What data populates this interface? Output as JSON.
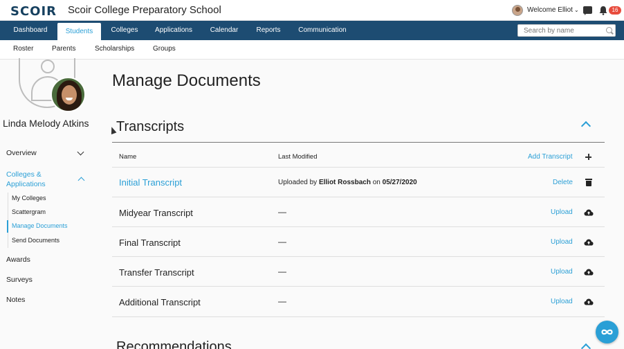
{
  "header": {
    "logo": "SCOIR",
    "school": "Scoir College Preparatory School",
    "welcome": "Welcome Elliot",
    "notification_count": "16"
  },
  "nav": {
    "tabs": [
      "Dashboard",
      "Students",
      "Colleges",
      "Applications",
      "Calendar",
      "Reports",
      "Communication"
    ],
    "active": "Students",
    "search_placeholder": "Search by name"
  },
  "subnav": {
    "items": [
      "Roster",
      "Parents",
      "Scholarships",
      "Groups"
    ]
  },
  "sidebar": {
    "student_name": "Linda Melody Atkins",
    "overview": "Overview",
    "colleges_applications": "Colleges & Applications",
    "sub_items": [
      "My Colleges",
      "Scattergram",
      "Manage Documents",
      "Send Documents"
    ],
    "active_sub_item": "Manage Documents",
    "awards": "Awards",
    "surveys": "Surveys",
    "notes": "Notes"
  },
  "main": {
    "page_title": "Manage Documents",
    "section_title": "Transcripts",
    "columns": {
      "name": "Name",
      "last_modified": "Last Modified",
      "add_action": "Add Transcript"
    },
    "rows": [
      {
        "name": "Initial Transcript",
        "uploaded_prefix": "Uploaded by",
        "uploaded_by": "Elliot Rossbach",
        "uploaded_on": "on",
        "date": "05/27/2020",
        "action": "Delete"
      },
      {
        "name": "Midyear Transcript",
        "last_modified": "—",
        "action": "Upload"
      },
      {
        "name": "Final Transcript",
        "last_modified": "—",
        "action": "Upload"
      },
      {
        "name": "Transfer Transcript",
        "last_modified": "—",
        "action": "Upload"
      },
      {
        "name": "Additional Transcript",
        "last_modified": "—",
        "action": "Upload"
      }
    ],
    "next_section_title": "Recommendations"
  },
  "colors": {
    "nav_bg": "#1d4c72",
    "accent": "#2a9fd6",
    "badge": "#e84c3d"
  },
  "icons": [
    "chat-icon",
    "bell-icon",
    "search-icon",
    "plus-icon",
    "trash-icon",
    "cloud-upload-icon",
    "chevron-up-icon",
    "chevron-down-icon",
    "help-icon"
  ]
}
